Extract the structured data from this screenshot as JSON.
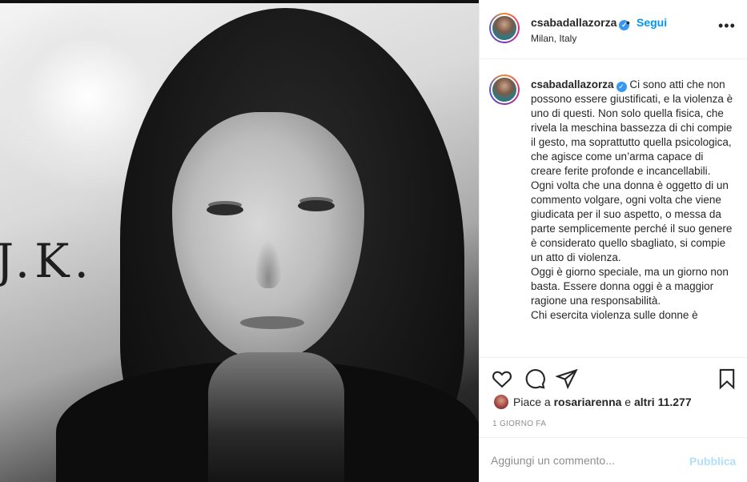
{
  "photo": {
    "pillow_text": "J.K."
  },
  "header": {
    "username": "csabadallazorza",
    "dot": "•",
    "follow_label": "Segui",
    "location": "Milan, Italy",
    "more_label": "•••"
  },
  "caption": {
    "username": "csabadallazorza",
    "paragraphs": [
      "Ci sono atti che non possono essere giustificati, e la violenza è uno di questi. Non solo quella fisica, che rivela la meschina bassezza di chi compie il gesto, ma soprattutto quella psicologica, che agisce come un’arma capace di creare ferite profonde e incancellabili.",
      "Ogni volta che una donna è oggetto di un commento volgare, ogni volta che viene giudicata per il suo aspetto, o messa da parte semplicemente perché il suo genere è considerato quello sbagliato, si compie un atto di violenza.",
      "Oggi è giorno speciale, ma un giorno non basta. Essere donna oggi è a maggior ragione una responsabilità.",
      "Chi esercita violenza sulle donne è"
    ]
  },
  "actions": {
    "like_icon": "heart-icon",
    "comment_icon": "comment-icon",
    "share_icon": "paper-plane-icon",
    "save_icon": "bookmark-icon"
  },
  "likes": {
    "prefix": "Piace a ",
    "user": "rosariarenna",
    "middle": " e ",
    "others": "altri 11.277"
  },
  "timestamp": "1 GIORNO FA",
  "comment": {
    "placeholder": "Aggiungi un commento...",
    "publish_label": "Pubblica"
  },
  "colors": {
    "link_blue": "#0095f6",
    "publish_disabled": "#b2dffc",
    "verified": "#3897f0",
    "muted": "#8e8e8e"
  }
}
